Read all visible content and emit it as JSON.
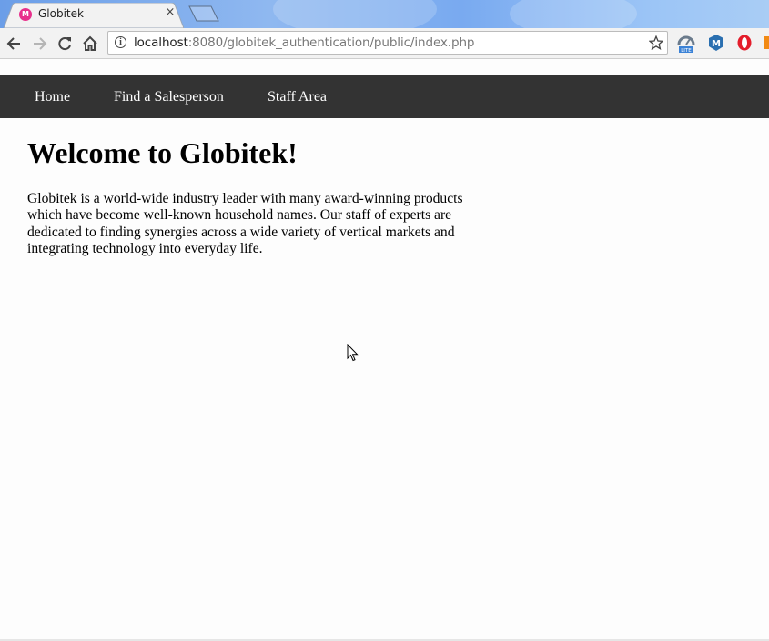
{
  "browser": {
    "tab": {
      "title": "Globitek",
      "favicon_text": "M",
      "close_glyph": "×"
    },
    "address": {
      "host": "localhost",
      "rest": ":8080/globitek_authentication/public/index.php"
    },
    "icons": {
      "back": "arrow-left-icon",
      "forward": "arrow-right-icon",
      "reload": "reload-icon",
      "home": "home-icon",
      "info": "info-icon",
      "bookmark": "star-icon",
      "ext1": "speed-lite-extension-icon",
      "ext2": "m-extension-icon",
      "ext3": "opera-extension-icon"
    },
    "ext_lite_label": "LITE",
    "ext_m_label": "M"
  },
  "site": {
    "nav": [
      {
        "label": "Home"
      },
      {
        "label": "Find a Salesperson"
      },
      {
        "label": "Staff Area"
      }
    ],
    "heading": "Welcome to Globitek!",
    "intro": "Globitek is a world-wide industry leader with many award-winning products which have become well-known household names. Our staff of experts are dedicated to finding synergies across a wide variety of vertical markets and integrating technology into everyday life."
  },
  "colors": {
    "nav_bg": "#333333",
    "nav_text": "#ffffff",
    "page_bg": "#fdfdfd",
    "favicon": "#e8308c"
  }
}
